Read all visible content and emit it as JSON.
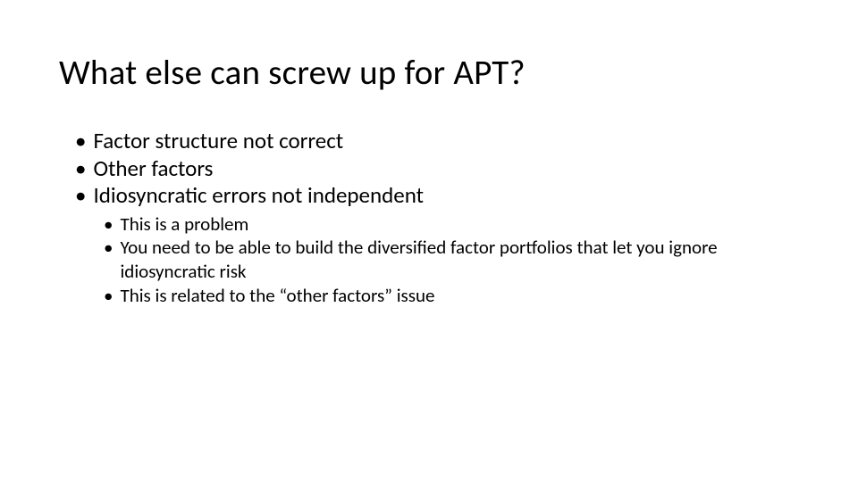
{
  "title": "What else can screw up for APT?",
  "bullets": {
    "b1": "Factor structure not correct",
    "b2": "Other factors",
    "b3": "Idiosyncratic errors not independent"
  },
  "subs": {
    "s1": "This is a problem",
    "s2": "You need to be able to build the diversified factor portfolios that let you ignore idiosyncratic risk",
    "s3": "This is related to the “other factors” issue"
  }
}
